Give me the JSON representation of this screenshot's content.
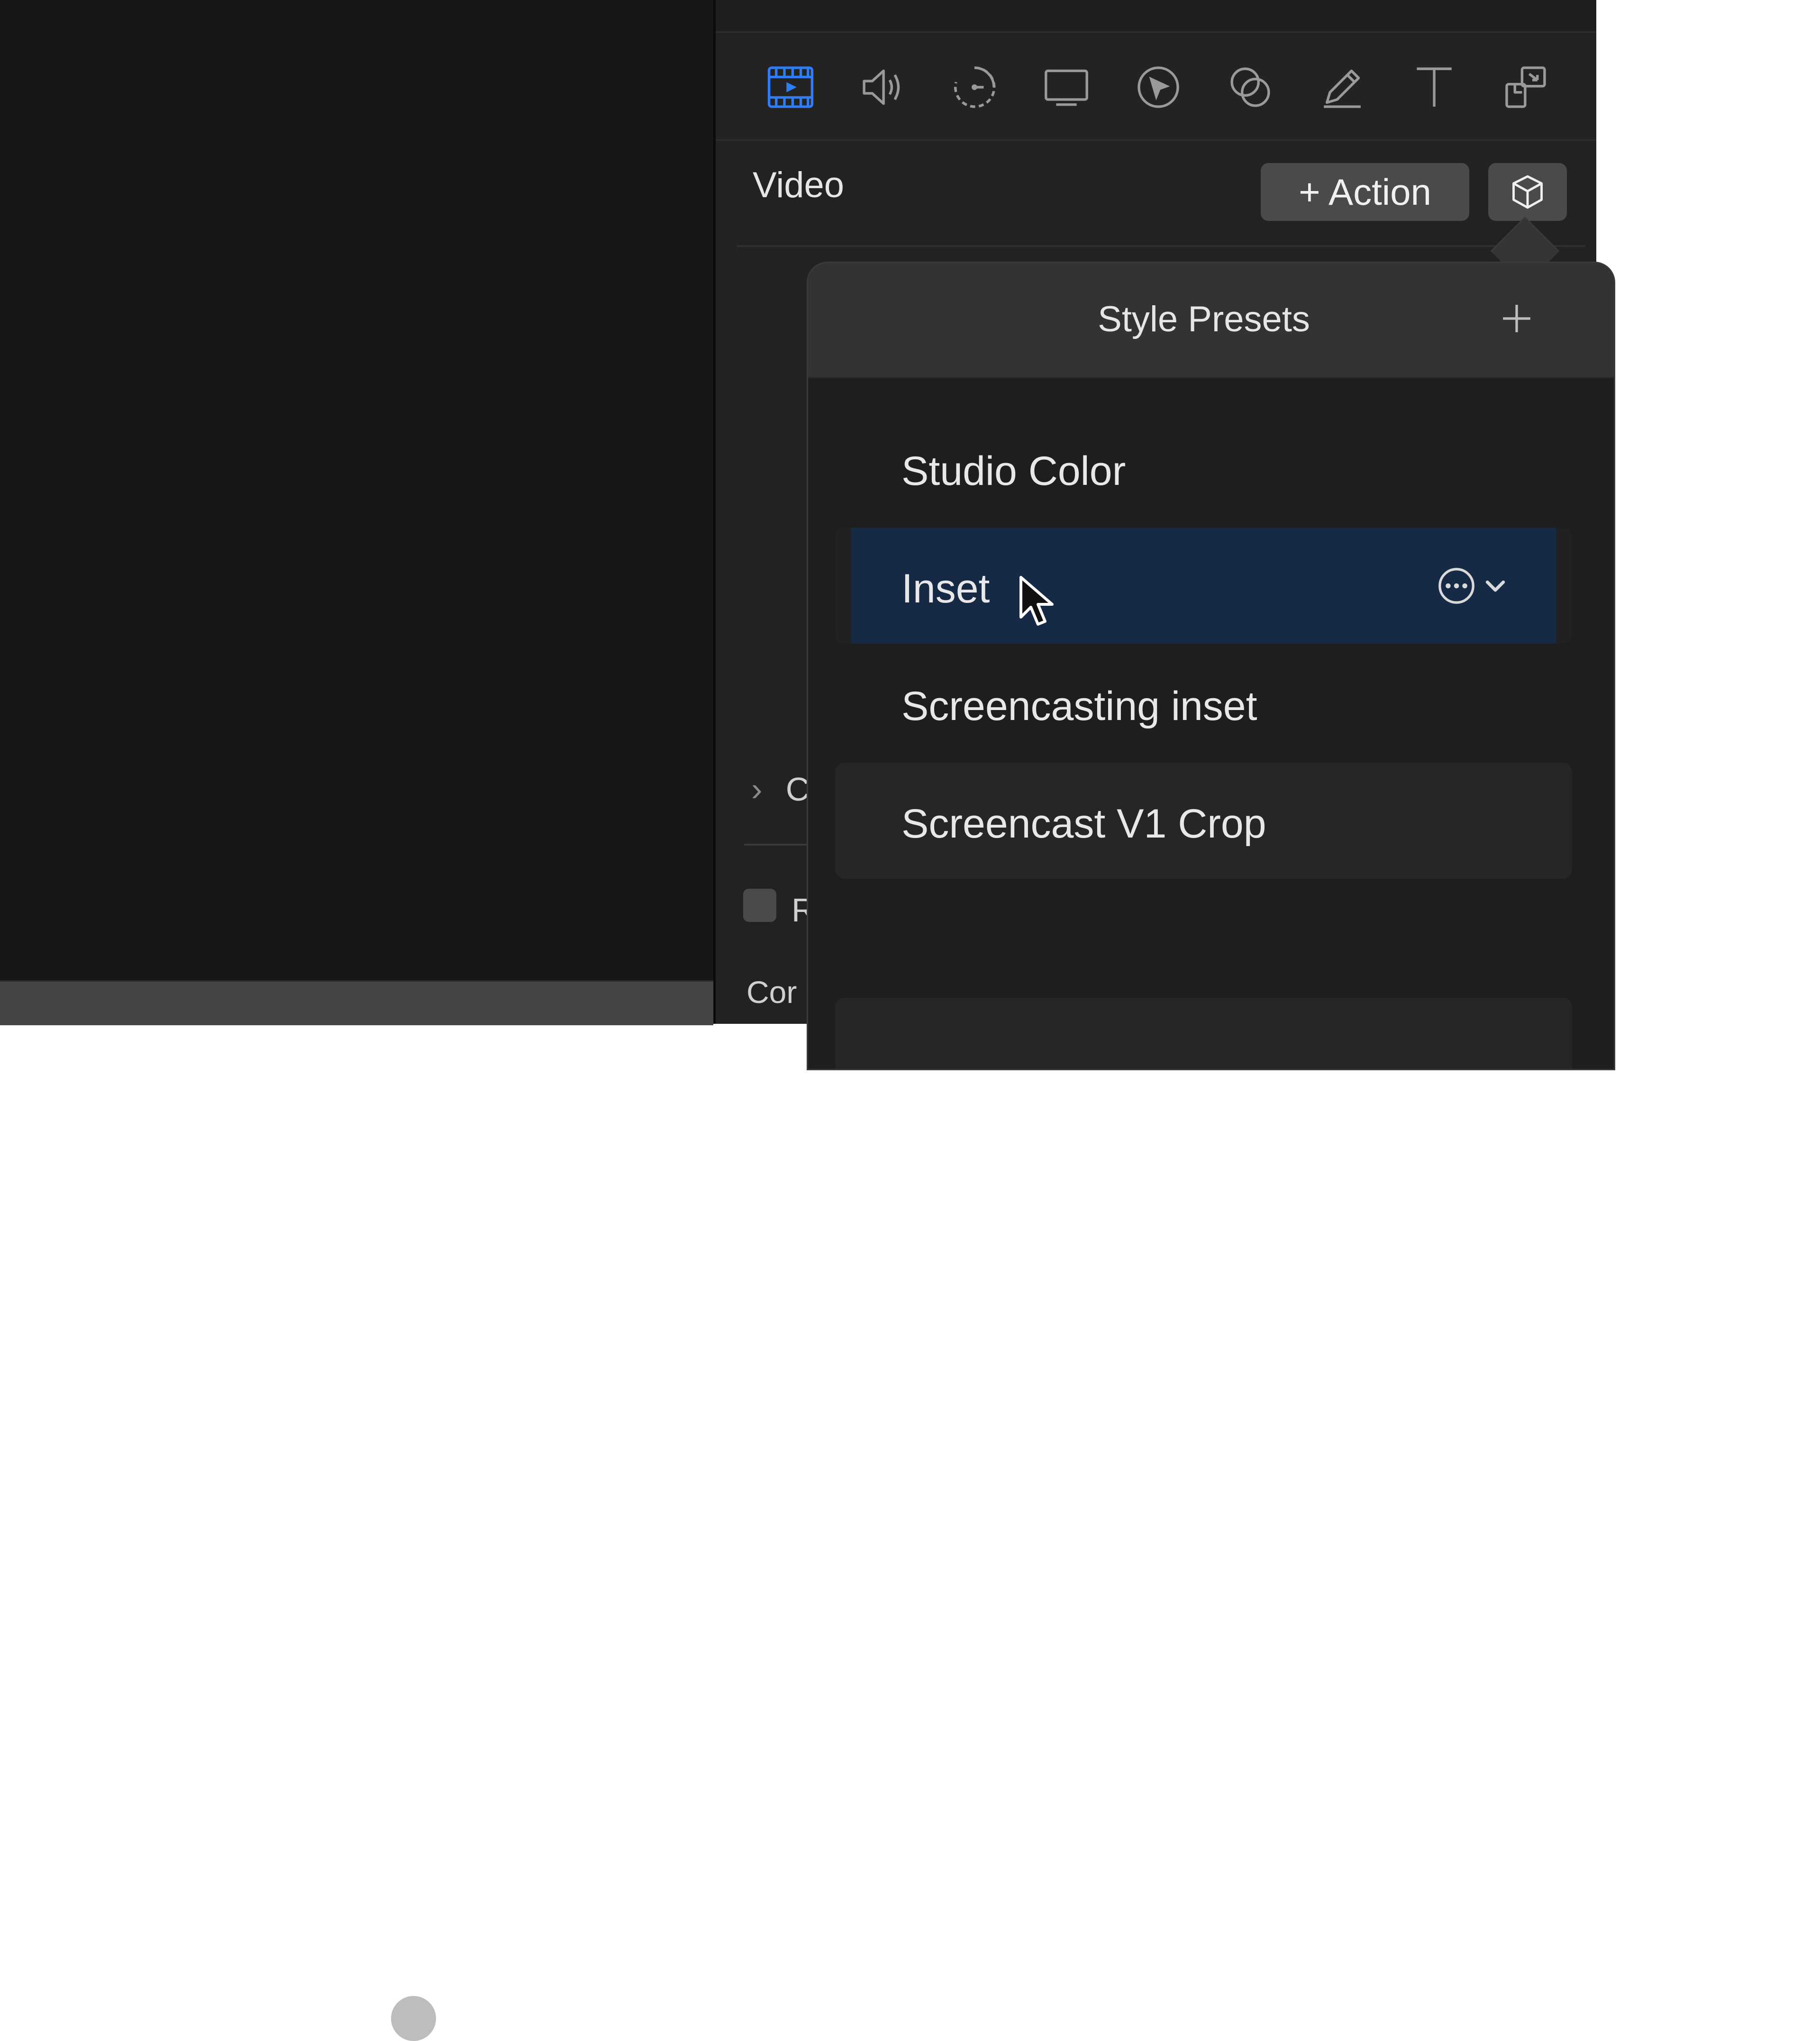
{
  "inspector": {
    "toolbar_icons": [
      {
        "name": "video-film-icon",
        "active": true
      },
      {
        "name": "audio-speaker-icon",
        "active": false
      },
      {
        "name": "animation-timer-icon",
        "active": false
      },
      {
        "name": "screen-display-icon",
        "active": false
      },
      {
        "name": "cursor-target-icon",
        "active": false
      },
      {
        "name": "shapes-circles-icon",
        "active": false
      },
      {
        "name": "pencil-annotation-icon",
        "active": false
      },
      {
        "name": "text-icon",
        "active": false
      },
      {
        "name": "callout-icon",
        "active": false
      }
    ],
    "title": "Video",
    "action_button": "+ Action",
    "style_presets_button_icon": "cube-icon",
    "hidden_rows": {
      "group_label": "C",
      "checkbox_label": "R",
      "bottom_label": "Cor"
    }
  },
  "popover": {
    "title": "Style Presets",
    "add_icon": "plus-icon",
    "presets": [
      {
        "label": "Studio Color",
        "selected": false
      },
      {
        "label": "Inset",
        "selected": true
      },
      {
        "label": "Screencasting inset",
        "selected": false
      },
      {
        "label": "Screencast V1 Crop",
        "selected": false
      }
    ],
    "row_menu_icons": [
      "more-options-icon",
      "chevron-down-icon"
    ]
  },
  "colors": {
    "accent": "#2e7cf6",
    "selection": "#162a45",
    "panel": "#222223",
    "canvas": "#161718"
  }
}
